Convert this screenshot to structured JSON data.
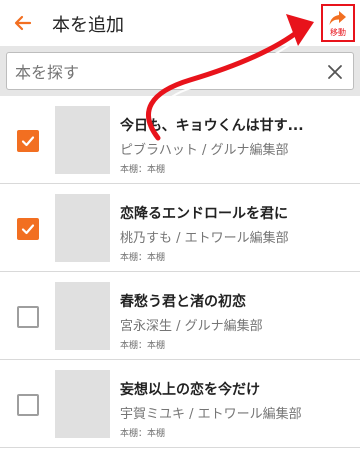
{
  "colors": {
    "accent": "#f26f21",
    "annotation_red": "#e8131b"
  },
  "header": {
    "back_icon": "arrow-left-icon",
    "title": "本を追加",
    "move_icon": "share-forward-icon",
    "move_label": "移動"
  },
  "search": {
    "placeholder": "本を探す",
    "value": "",
    "clear_icon": "close-icon"
  },
  "books": [
    {
      "title": "今日も、キョウくんは甘す...",
      "meta": "ピブラハット / グルナ編集部",
      "shelf": "本棚：本棚",
      "checked": true
    },
    {
      "title": "恋降るエンドロールを君に",
      "meta": "桃乃すも / エトワール編集部",
      "shelf": "本棚：本棚",
      "checked": true
    },
    {
      "title": "春愁う君と渚の初恋",
      "meta": "宮永深生 / グルナ編集部",
      "shelf": "本棚：本棚",
      "checked": false
    },
    {
      "title": "妄想以上の恋を今だけ",
      "meta": "宇賀ミユキ / エトワール編集部",
      "shelf": "本棚：本棚",
      "checked": false
    }
  ]
}
